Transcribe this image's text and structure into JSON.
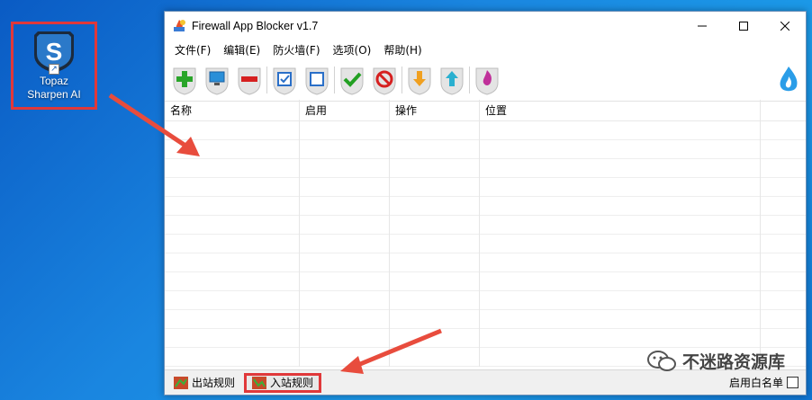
{
  "desktop": {
    "icon_label_line1": "Topaz",
    "icon_label_line2": "Sharpen AI"
  },
  "window": {
    "title": "Firewall App Blocker v1.7",
    "menu": [
      "文件(F)",
      "编辑(E)",
      "防火墙(F)",
      "选项(O)",
      "帮助(H)"
    ],
    "toolbar_icons": [
      "add-icon",
      "monitor-icon",
      "remove-icon",
      "check-square-icon",
      "square-icon",
      "enable-check-icon",
      "block-icon",
      "arrow-down-icon",
      "arrow-up-icon",
      "flame-icon"
    ],
    "columns": [
      "名称",
      "启用",
      "操作",
      "位置",
      ""
    ],
    "row_count": 13,
    "tabs": [
      {
        "label": "出站规则",
        "active": false
      },
      {
        "label": "入站规则",
        "active": true
      }
    ],
    "whitelist_label": "启用白名单"
  },
  "watermark": "不迷路资源库",
  "colors": {
    "highlight": "#e0383a",
    "desktop": "#1a86e0"
  }
}
